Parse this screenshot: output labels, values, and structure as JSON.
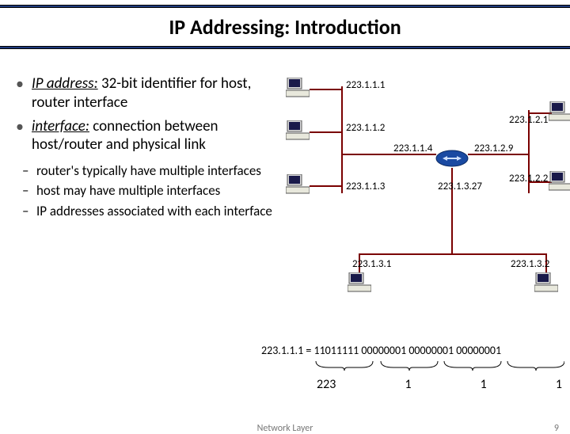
{
  "title": "IP Addressing: Introduction",
  "bullets": {
    "b1_term": "IP address:",
    "b1_rest": " 32-bit identifier for host, router interface",
    "b2_term": "interface:",
    "b2_rest": " connection between host/router and physical link"
  },
  "subs": {
    "s1": "router's typically have multiple interfaces",
    "s2": "host may have multiple interfaces",
    "s3": "IP addresses associated with each interface"
  },
  "ips": {
    "ip111": "223.1.1.1",
    "ip112": "223.1.1.2",
    "ip113": "223.1.1.3",
    "ip114": "223.1.1.4",
    "ip121": "223.1.2.1",
    "ip122": "223.1.2.2",
    "ip129": "223.1.2.9",
    "ip131": "223.1.3.1",
    "ip132": "223.1.3.2",
    "ip1327": "223.1.3.27"
  },
  "binary": "223.1.1.1 = 11011111 00000001 00000001 00000001",
  "octets": {
    "o1": "223",
    "o2": "1",
    "o3": "1",
    "o4": "1"
  },
  "footer": {
    "mid": "Network Layer",
    "right": "9"
  }
}
